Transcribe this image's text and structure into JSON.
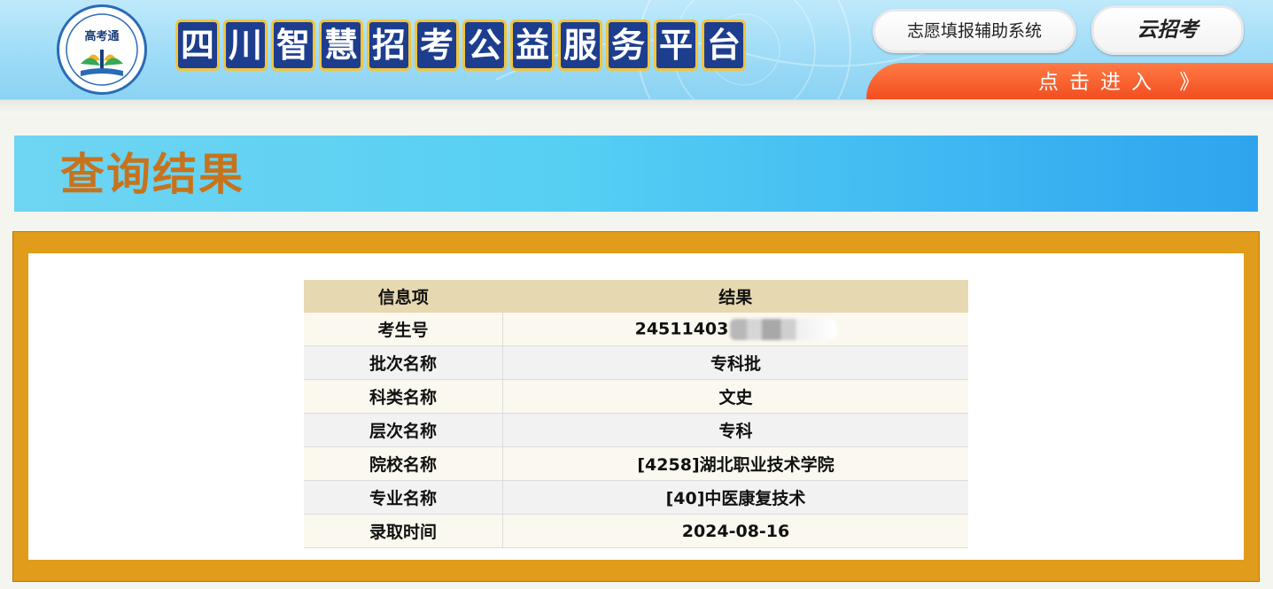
{
  "header": {
    "logo_text": "高考通",
    "site_title_chars": [
      "四",
      "川",
      "智",
      "慧",
      "招",
      "考",
      "公",
      "益",
      "服",
      "务",
      "平",
      "台"
    ],
    "zhiyuan_button": "志愿填报辅助系统",
    "yunzhaokao_button": "云招考",
    "enter_button": "点击进入 》"
  },
  "result_section": {
    "title": "查询结果"
  },
  "table": {
    "headers": [
      "信息项",
      "结果"
    ],
    "rows": [
      {
        "label": "考生号",
        "value": "24511403"
      },
      {
        "label": "批次名称",
        "value": "专科批"
      },
      {
        "label": "科类名称",
        "value": "文史"
      },
      {
        "label": "层次名称",
        "value": "专科"
      },
      {
        "label": "院校名称",
        "value": "[4258]湖北职业技术学院"
      },
      {
        "label": "专业名称",
        "value": "[40]中医康复技术"
      },
      {
        "label": "录取时间",
        "value": "2024-08-16"
      }
    ]
  },
  "colors": {
    "title_color": "#c7731e",
    "panel_border": "#e09c1a",
    "table_header_bg": "#e6d8b0",
    "enter_bar": "#f24a1d",
    "title_tile_bg": "#1d3e8f"
  }
}
